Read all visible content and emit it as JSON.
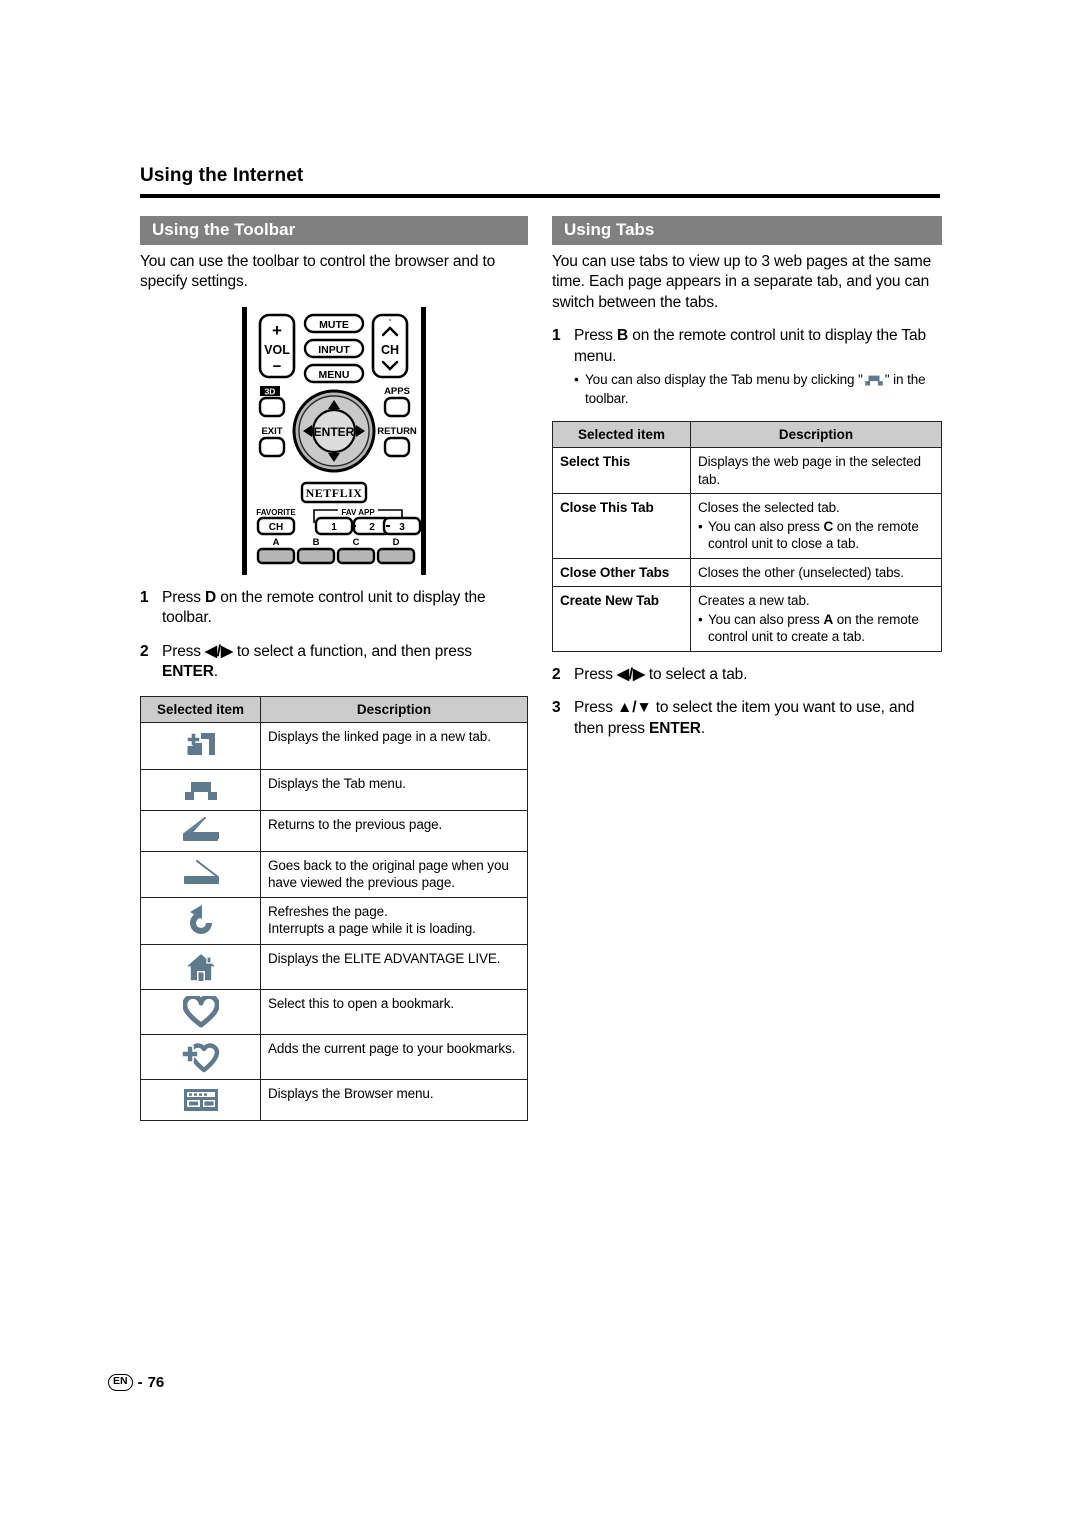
{
  "page": {
    "chapter_title": "Using the Internet",
    "footer_lang": "EN",
    "footer_dash": "-",
    "footer_page": "76"
  },
  "left": {
    "section_title": "Using the Toolbar",
    "intro": "You can use the toolbar to control the browser and to specify settings.",
    "steps": [
      {
        "num": "1",
        "pre": "Press ",
        "key": "D",
        "post": " on the remote control unit to display the toolbar."
      },
      {
        "num": "2",
        "pre": "Press ",
        "arrows": "◀/▶",
        "mid": " to select a function, and then press ",
        "key": "ENTER",
        "post": "."
      }
    ],
    "table": {
      "headers": [
        "Selected item",
        "Description"
      ],
      "rows": [
        {
          "icon": "new-tab-icon",
          "description": "Displays the linked page in a new tab."
        },
        {
          "icon": "tab-menu-icon",
          "description": "Displays the Tab menu."
        },
        {
          "icon": "back-arrow-icon",
          "description": "Returns to the previous page."
        },
        {
          "icon": "forward-arrow-icon",
          "description": "Goes back to the original page when you have viewed the previous page."
        },
        {
          "icon": "refresh-icon",
          "description": "Refreshes the page.",
          "description2": "Interrupts a page while it is loading."
        },
        {
          "icon": "home-icon",
          "description": "Displays the ELITE ADVANTAGE LIVE."
        },
        {
          "icon": "bookmark-heart-icon",
          "description": "Select this to open a bookmark."
        },
        {
          "icon": "add-bookmark-icon",
          "description": "Adds the current page to your bookmarks."
        },
        {
          "icon": "browser-menu-icon",
          "description": "Displays the Browser menu."
        }
      ]
    }
  },
  "right": {
    "section_title": "Using Tabs",
    "intro": "You can use tabs to view up to 3 web pages at the same time. Each page appears in a separate tab, and you can switch between the tabs.",
    "step1": {
      "num": "1",
      "pre": "Press ",
      "key": "B",
      "post": " on the remote control unit to display the Tab menu."
    },
    "step1_bullet": {
      "dot": "•",
      "pre": "You can also display the Tab menu by clicking \"",
      "post": "\" in the toolbar."
    },
    "table": {
      "headers": [
        "Selected item",
        "Description"
      ],
      "rows": [
        {
          "name": "Select This",
          "description": "Displays the web page in the selected tab."
        },
        {
          "name": "Close This Tab",
          "description": "Closes the selected tab.",
          "bullet_dot": "•",
          "bullet_pre": "You can also press ",
          "bullet_key": "C",
          "bullet_post": " on the remote control unit to close a tab."
        },
        {
          "name": "Close Other Tabs",
          "description": "Closes the other (unselected) tabs."
        },
        {
          "name": "Create New Tab",
          "description": "Creates a new tab.",
          "bullet_dot": "•",
          "bullet_pre": "You can also press ",
          "bullet_key": "A",
          "bullet_post": " on the remote control unit to create a tab."
        }
      ]
    },
    "step2": {
      "num": "2",
      "pre": "Press ",
      "arrows": "◀/▶",
      "post": " to select a tab."
    },
    "step3": {
      "num": "3",
      "pre": "Press ",
      "arrows": "▲/▼",
      "mid": " to select the item you want to use, and then press ",
      "key": "ENTER",
      "post": "."
    }
  },
  "remote": {
    "vol_plus": "+",
    "vol_label": "VOL",
    "vol_minus": "−",
    "mute": "MUTE",
    "input": "INPUT",
    "menu": "MENU",
    "ch_label": "CH",
    "ch_degree": "°",
    "three_d": "3D",
    "apps": "APPS",
    "exit": "EXIT",
    "enter": "ENTER",
    "return": "RETURN",
    "netflix": "NETFLIX",
    "favorite": "FAVORITE",
    "favorite_ch": "CH",
    "fav_app": "FAV APP",
    "fav_1": "1",
    "fav_2": "2",
    "fav_3": "3",
    "btn_a": "A",
    "btn_b": "B",
    "btn_c": "C",
    "btn_d": "D"
  },
  "colors": {
    "section_bar": "#808080",
    "table_header": "#cccccc",
    "icon_slate": "#5e7a8c",
    "rule": "#000000"
  }
}
